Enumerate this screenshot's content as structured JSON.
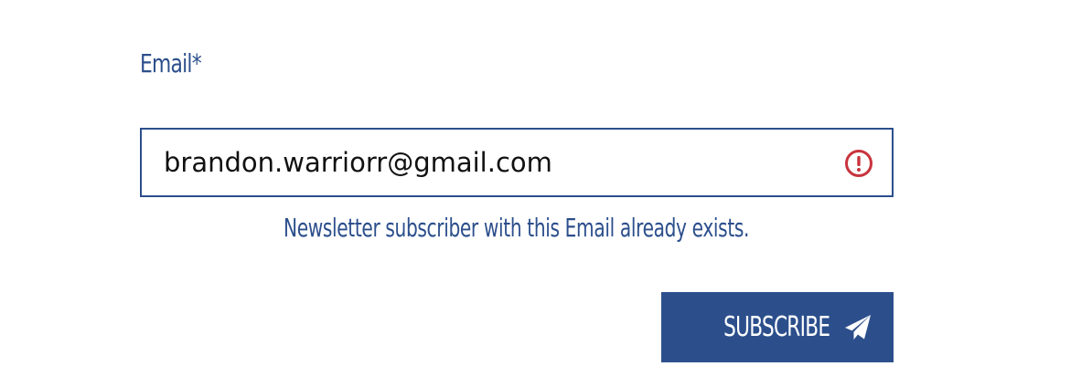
{
  "form": {
    "email_label": "Email*",
    "email_value": "brandon.warriorr@gmail.com",
    "error_message": "Newsletter subscriber with this Email already exists.",
    "subscribe_label": "SUBSCRIBE"
  },
  "icons": {
    "field_status": "alert-circle-icon",
    "submit": "paper-plane-icon"
  },
  "colors": {
    "accent": "#2c4f8c",
    "error": "#c8343d",
    "text": "#111111",
    "background": "#ffffff"
  }
}
